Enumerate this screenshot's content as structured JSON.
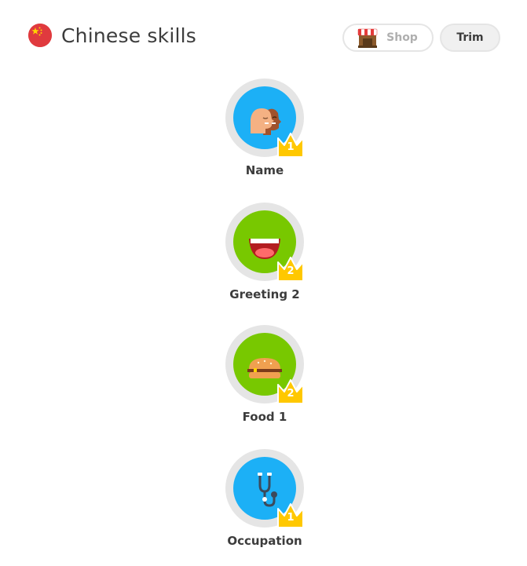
{
  "header": {
    "title": "Chinese skills",
    "flag_icon": "china-flag-icon"
  },
  "buttons": {
    "shop_label": "Shop",
    "trim_label": "Trim"
  },
  "skills": [
    {
      "label": "Name",
      "crown_level": "1",
      "circle_color": "#1cb0f6",
      "icon": "two-faces-icon"
    },
    {
      "label": "Greeting 2",
      "crown_level": "2",
      "circle_color": "#78c800",
      "icon": "smiling-mouth-icon"
    },
    {
      "label": "Food 1",
      "crown_level": "2",
      "circle_color": "#78c800",
      "icon": "burger-icon"
    },
    {
      "label": "Occupation",
      "crown_level": "1",
      "circle_color": "#1cb0f6",
      "icon": "stethoscope-icon"
    }
  ],
  "colors": {
    "crown": "#ffc800",
    "ring": "#e5e5e5",
    "flag": "#e03a3e"
  }
}
